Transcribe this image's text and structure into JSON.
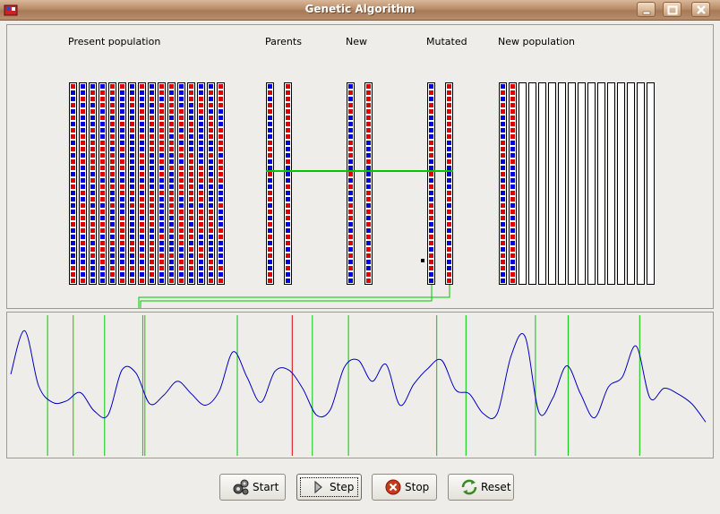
{
  "window": {
    "title": "Genetic Algorithm",
    "colors": {
      "titlebar": "#b98c68",
      "panel_bg": "#efedea"
    }
  },
  "labels": {
    "present": "Present population",
    "parents": "Parents",
    "new": "New",
    "mutated": "Mutated",
    "new_population": "New population"
  },
  "buttons": {
    "start": "Start",
    "step": "Step",
    "stop": "Stop",
    "reset": "Reset"
  },
  "icons": {
    "app": "app-icon",
    "minimize": "minimize-icon",
    "maximize": "maximize-icon",
    "close": "close-icon",
    "start": "gears-icon",
    "step": "play-arrow-icon",
    "stop": "stop-x-icon",
    "reset": "recycle-icon"
  },
  "genes": {
    "colors": {
      "zero": "#0000dd",
      "one": "#dd0000",
      "border": "#000000",
      "link": "#00c800",
      "best": "#e00000",
      "curve": "#0000c0"
    },
    "chromosome_length": 32,
    "present_population": [
      "10010101101011011000011000000111",
      "00101000111010000101111101000101",
      "01101001011111010010101110110000",
      "01110100011111101110101101111000",
      "11011010110111101001000101000110",
      "10000010001011001100011111000101",
      "00110011000000000101000001100101",
      "10001100100110101011101101010101",
      "00100110111000000111111001111110",
      "11011111111010100100000010011100",
      "10111011011001000111100100010001",
      "00001110101101111100111111001101",
      "11100011000111111110110110101100",
      "00111000000001110110111100110000",
      "01010111100100010000111100001101",
      "11110001111011110001000110000101"
    ],
    "parents": [
      "01011000011100100110101010110011",
      "11111111100010001001110011010100"
    ],
    "new": [
      "01011000011100101001110011010100",
      "11111111100010000110101010110011"
    ],
    "mutated": [
      "01011000011100101001110011011100",
      "11111111100010000110101010110011"
    ],
    "new_population": [
      "01011000011100101001110011011100",
      "11111111100010000110101010110011"
    ],
    "new_population_capacity": 16,
    "crossover_point": 14,
    "mutation_point": 28
  },
  "chart_data": {
    "type": "line",
    "title": "",
    "xlabel": "",
    "ylabel": "",
    "xlim": [
      0,
      100
    ],
    "ylim": [
      0,
      10
    ],
    "grid": false,
    "curve_x": [
      0,
      2,
      4,
      6,
      8,
      10,
      12,
      14,
      16,
      18,
      20,
      22,
      24,
      26,
      28,
      30,
      32,
      34,
      36,
      38,
      40,
      42,
      44,
      46,
      48,
      50,
      52,
      54,
      56,
      58,
      60,
      62,
      64,
      66,
      68,
      70,
      72,
      74,
      76,
      78,
      80,
      82,
      84,
      86,
      88,
      90,
      92,
      94,
      96,
      98,
      100
    ],
    "curve_y": [
      5.8,
      8.9,
      5.0,
      3.8,
      3.9,
      4.5,
      3.2,
      2.9,
      6.1,
      5.9,
      3.7,
      4.3,
      5.3,
      4.4,
      3.6,
      4.6,
      7.4,
      5.6,
      3.8,
      6.0,
      6.1,
      4.8,
      2.9,
      3.3,
      6.3,
      6.8,
      5.3,
      6.5,
      3.6,
      5.1,
      6.2,
      6.8,
      4.7,
      4.4,
      3.0,
      3.0,
      7.1,
      8.5,
      3.1,
      4.1,
      6.4,
      4.4,
      2.7,
      4.9,
      5.6,
      7.8,
      4.1,
      4.8,
      4.4,
      3.7,
      2.4
    ],
    "individuals_x": [
      5.3,
      9.0,
      13.5,
      19.0,
      19.3,
      32.6,
      43.4,
      48.6,
      61.3,
      65.5,
      75.5,
      80.2,
      90.5
    ],
    "best_x": 40.5
  }
}
